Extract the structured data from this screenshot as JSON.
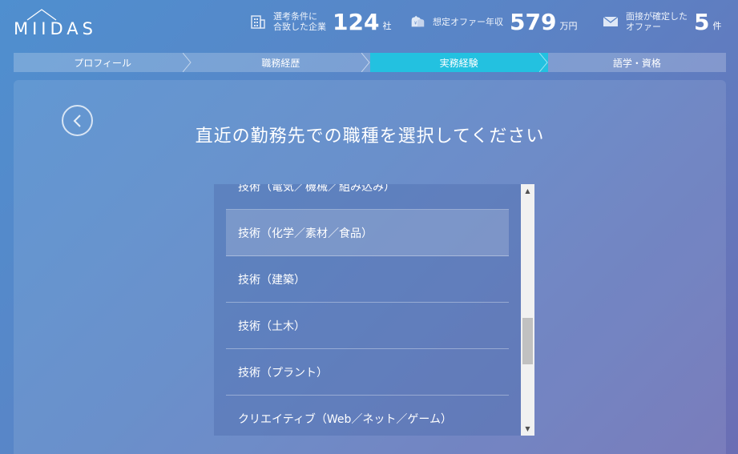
{
  "header": {
    "logo": "MIIDAS",
    "stats": [
      {
        "icon": "building-icon",
        "label": "選考条件に\n合致した企業",
        "value": "124",
        "unit": "社"
      },
      {
        "icon": "money-bag-icon",
        "label": "想定オファー年収",
        "value": "579",
        "unit": "万円"
      },
      {
        "icon": "envelope-icon",
        "label": "面接が確定した\nオファー",
        "value": "5",
        "unit": "件"
      }
    ]
  },
  "steps": [
    {
      "label": "プロフィール",
      "active": false
    },
    {
      "label": "職務経歴",
      "active": false
    },
    {
      "label": "実務経験",
      "active": true
    },
    {
      "label": "語学・資格",
      "active": false
    }
  ],
  "main": {
    "title": "直近の勤務先での職種を選択してください",
    "back_icon": "chevron-left-icon",
    "options": [
      "技術（電気／機械／組み込み）",
      "技術（化学／素材／食品）",
      "技術（建築）",
      "技術（土木）",
      "技術（プラント）",
      "クリエイティブ（Web／ネット／ゲーム）"
    ],
    "highlighted_index": 1
  }
}
